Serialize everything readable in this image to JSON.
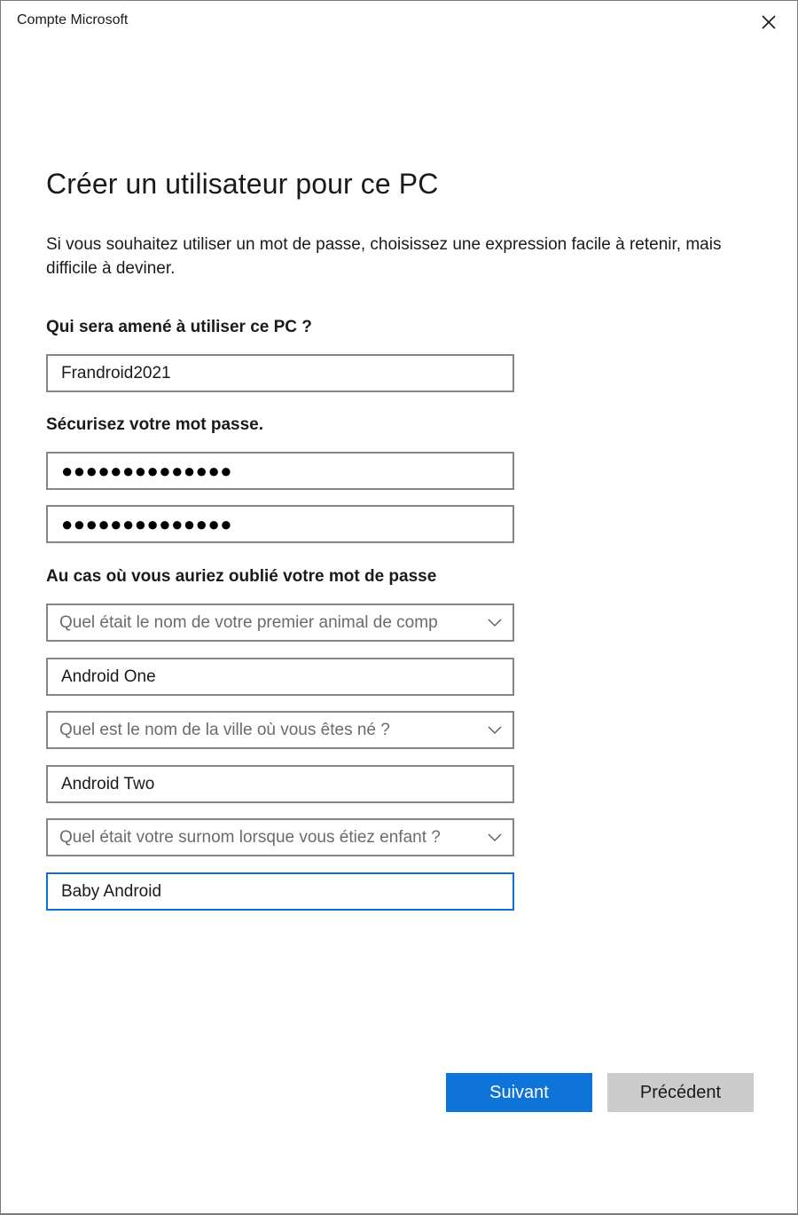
{
  "window": {
    "title": "Compte Microsoft",
    "close_icon": "close-icon"
  },
  "page": {
    "title": "Créer un utilisateur pour ce PC",
    "description": "Si vous souhaitez utiliser un mot de passe, choisissez une expression facile à retenir, mais difficile à deviner."
  },
  "user": {
    "label": "Qui sera amené à utiliser ce PC ?",
    "username_value": "Frandroid2021"
  },
  "password": {
    "label": "Sécurisez votre mot passe.",
    "password_masked": "●●●●●●●●●●●●●●",
    "confirm_masked": "●●●●●●●●●●●●●●"
  },
  "security": {
    "label": "Au cas où vous auriez oublié votre mot de passe",
    "questions": [
      {
        "question": "Quel était le nom de votre premier animal de comp",
        "answer": "Android One"
      },
      {
        "question": "Quel est le nom de la ville où vous êtes né ?",
        "answer": "Android Two"
      },
      {
        "question": "Quel était votre surnom lorsque vous étiez enfant ?",
        "answer": "Baby Android"
      }
    ],
    "chevron_icon": "chevron-down-icon"
  },
  "buttons": {
    "next_label": "Suivant",
    "back_label": "Précédent"
  },
  "colors": {
    "accent": "#0f74d8",
    "focus_border": "#0f6fd1",
    "secondary_button": "#cccccc",
    "field_border": "#858585"
  }
}
